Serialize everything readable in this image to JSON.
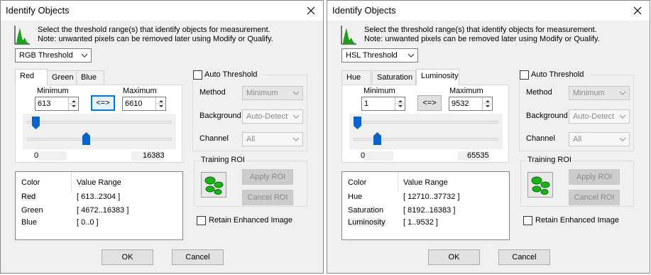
{
  "dialogs": [
    {
      "title": "Identify Objects",
      "desc_line1": "Select the threshold range(s) that identify objects for measurement.",
      "desc_line2": "Note: unwanted pixels can be removed later using Modify or Qualify.",
      "threshold_mode": "RGB Threshold",
      "tabs": [
        "Red",
        "Green",
        "Blue"
      ],
      "active_tab": "Red",
      "minimum_label": "Minimum",
      "maximum_label": "Maximum",
      "minimum": "613",
      "maximum": "6610",
      "swap_label": "<=>",
      "range_min": "0",
      "range_max": "16383",
      "min_level": 0.037,
      "max_level": 0.403,
      "auto_threshold_label": "Auto Threshold",
      "method_label": "Method",
      "method_value": "Minimum",
      "background_label": "Background",
      "background_value": "Auto-Detect",
      "channel_label": "Channel",
      "channel_value": "All",
      "training_roi_label": "Training ROI",
      "apply_roi_label": "Apply ROI",
      "cancel_roi_label": "Cancel ROI",
      "retain_label": "Retain Enhanced Image",
      "table": {
        "headers": [
          "Color",
          "Value Range"
        ],
        "rows": [
          {
            "color": "Red",
            "range": "[ 613..2304 ]"
          },
          {
            "color": "Green",
            "range": "[ 4672..16383 ]"
          },
          {
            "color": "Blue",
            "range": "[ 0..0 ]"
          }
        ]
      },
      "ok_label": "OK",
      "cancel_label": "Cancel"
    },
    {
      "title": "Identify Objects",
      "desc_line1": "Select the threshold range(s) that identify objects for measurement.",
      "desc_line2": "Note: unwanted pixels can be removed later using Modify or Qualify.",
      "threshold_mode": "HSL Threshold",
      "tabs": [
        "Hue",
        "Saturation",
        "Luminosity"
      ],
      "active_tab": "Luminosity",
      "minimum_label": "Minimum",
      "maximum_label": "Maximum",
      "minimum": "1",
      "maximum": "9532",
      "swap_label": "<=>",
      "range_min": "0",
      "range_max": "65535",
      "min_level": 0.0,
      "max_level": 0.145,
      "auto_threshold_label": "Auto Threshold",
      "method_label": "Method",
      "method_value": "Minimum",
      "background_label": "Background",
      "background_value": "Auto-Detect",
      "channel_label": "Channel",
      "channel_value": "All",
      "training_roi_label": "Training ROI",
      "apply_roi_label": "Apply ROI",
      "cancel_roi_label": "Cancel ROI",
      "retain_label": "Retain Enhanced Image",
      "table": {
        "headers": [
          "Color",
          "Value Range"
        ],
        "rows": [
          {
            "color": "Hue",
            "range": "[ 12710..37732 ]"
          },
          {
            "color": "Saturation",
            "range": "[ 8192..16383 ]"
          },
          {
            "color": "Luminosity",
            "range": "[ 1..9532 ]"
          }
        ]
      },
      "ok_label": "OK",
      "cancel_label": "Cancel"
    }
  ],
  "colors": {
    "accent": "#0078d7",
    "thumb": "#0a64c8",
    "roi_green": "#18b418"
  }
}
